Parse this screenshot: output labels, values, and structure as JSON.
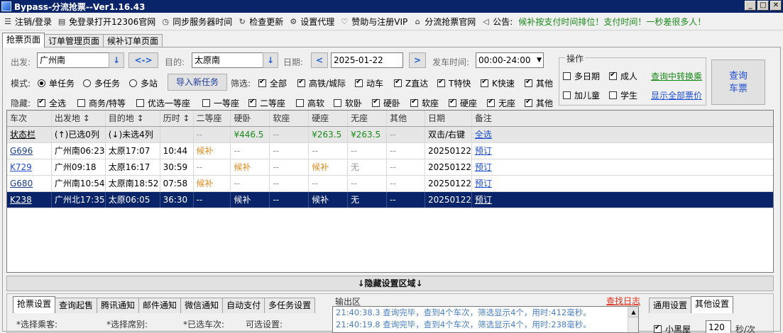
{
  "window": {
    "title": "Bypass-分流抢票--Ver1.16.43"
  },
  "menu": [
    {
      "label": "注销/登录",
      "icon": "menu-icon"
    },
    {
      "label": "免登录打开12306官网",
      "icon": "window-icon"
    },
    {
      "label": "同步服务器时间",
      "icon": "clock-icon"
    },
    {
      "label": "检查更新",
      "icon": "refresh-icon"
    },
    {
      "label": "设置代理",
      "icon": "gear-icon"
    },
    {
      "label": "赞助与注册VIP",
      "icon": "heart-icon"
    },
    {
      "label": "分流抢票官网",
      "icon": "home-icon"
    },
    {
      "label": "公告:",
      "icon": "speaker-icon"
    }
  ],
  "notice": "候补按支付时间排位！支付时间！一秒差很多人！",
  "tabs": [
    "抢票页面",
    "订单管理页面",
    "候补订单页面"
  ],
  "route": {
    "from_label": "出发:",
    "from_value": "广州南",
    "swap_label": "<->",
    "to_label": "目的:",
    "to_value": "太原南",
    "date_label": "日期:",
    "date_value": "2025-01-22",
    "prev": "<",
    "next": ">",
    "time_label": "发车时间:",
    "time_value": "00:00-24:00"
  },
  "mode": {
    "label": "模式:",
    "options": [
      {
        "label": "单任务",
        "selected": true
      },
      {
        "label": "多任务",
        "selected": false
      },
      {
        "label": "多站",
        "selected": false
      }
    ],
    "import_button": "导入新任务"
  },
  "filter": {
    "label": "筛选:",
    "items": [
      {
        "label": "全部",
        "checked": true
      },
      {
        "label": "高铁/城际",
        "checked": true
      },
      {
        "label": "动车",
        "checked": true
      },
      {
        "label": "Z直达",
        "checked": true
      },
      {
        "label": "T特快",
        "checked": true
      },
      {
        "label": "K快速",
        "checked": true
      },
      {
        "label": "其他",
        "checked": true
      }
    ]
  },
  "hide": {
    "label": "隐藏:",
    "items": [
      {
        "label": "全选",
        "checked": true
      },
      {
        "label": "商务/特等",
        "checked": false
      },
      {
        "label": "优选一等座",
        "checked": false
      },
      {
        "label": "一等座",
        "checked": false
      },
      {
        "label": "二等座",
        "checked": true
      },
      {
        "label": "高软",
        "checked": false
      },
      {
        "label": "软卧",
        "checked": false
      },
      {
        "label": "硬卧",
        "checked": true
      },
      {
        "label": "软座",
        "checked": true
      },
      {
        "label": "硬座",
        "checked": true
      },
      {
        "label": "无座",
        "checked": true
      },
      {
        "label": "其他",
        "checked": true
      }
    ]
  },
  "ops": {
    "legend": "操作",
    "multi_day": {
      "label": "多日期",
      "checked": false
    },
    "adult": {
      "label": "成人",
      "checked": true
    },
    "transfer_link": "查询中转换乘",
    "child": {
      "label": "加儿童",
      "checked": false
    },
    "student": {
      "label": "学生",
      "checked": false
    },
    "all_price_link": "显示全部票价",
    "query_button_line1": "查询",
    "query_button_line2": "车票"
  },
  "table": {
    "headers": [
      "车次",
      "出发地 ↕",
      "目的地 ↕",
      "历时 ↕",
      "二等座",
      "硬卧",
      "软座",
      "硬座",
      "无座",
      "其他",
      "日期",
      "备注"
    ],
    "status_row": [
      "状态栏",
      "(↑)已选0列",
      "(↓)未选4列",
      "",
      "--",
      "¥446.5",
      "--",
      "¥263.5",
      "¥263.5",
      "--",
      "双击/右键",
      "全选"
    ],
    "rows": [
      [
        "G696",
        "广州南06:23",
        "太原17:07",
        "10:44",
        "候补",
        "--",
        "--",
        "--",
        "--",
        "--",
        "20250122",
        "预订"
      ],
      [
        "K729",
        "广州09:18",
        "太原16:17",
        "30:59",
        "--",
        "候补",
        "--",
        "候补",
        "无",
        "--",
        "20250122",
        "预订"
      ],
      [
        "G680",
        "广州南10:54",
        "太原南18:52",
        "07:58",
        "候补",
        "--",
        "--",
        "--",
        "--",
        "--",
        "20250122",
        "预订"
      ],
      [
        "K238",
        "广州北17:35",
        "太原06:05",
        "36:30",
        "--",
        "候补",
        "--",
        "候补",
        "无",
        "--",
        "20250122",
        "预订"
      ]
    ]
  },
  "hide_area_label": "↓隐藏设置区域↓",
  "bottom": {
    "tabs": [
      "抢票设置",
      "查询起售",
      "腾讯通知",
      "邮件通知",
      "微信通知",
      "自动支付",
      "多任务设置"
    ],
    "fields": [
      "*选择乘客:",
      "*选择席别:",
      "*已选车次:",
      "可选设置:"
    ],
    "output_title": "输出区",
    "find_log": "查找日志",
    "log_lines": [
      "21:40:38.3  查询完毕，查到4个车次，筛选显示4个，用时:412毫秒。",
      "21:40:19.8  查询完毕，查到4个车次，筛选显示4个，用时:238毫秒。"
    ],
    "right_tabs": [
      "通用设置",
      "其他设置"
    ],
    "blackroom": {
      "label": "小黑屋",
      "checked": true
    },
    "seconds_value": "120",
    "seconds_unit": "秒/次"
  }
}
